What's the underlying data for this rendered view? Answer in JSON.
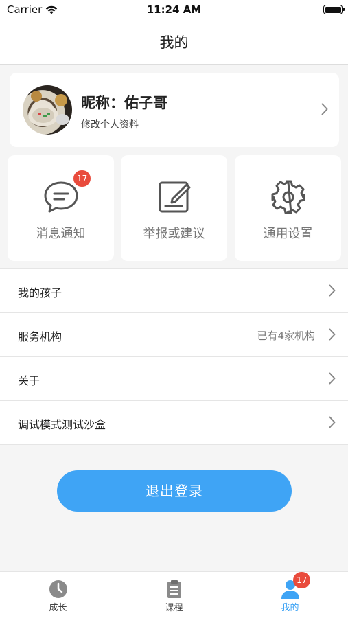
{
  "status_bar": {
    "carrier": "Carrier",
    "time": "11:24 AM"
  },
  "nav": {
    "title": "我的"
  },
  "profile": {
    "nickname": "昵称：佑子哥",
    "edit_label": "修改个人资料"
  },
  "tiles": [
    {
      "label": "消息通知",
      "icon": "chat-bubble-icon",
      "badge": "17"
    },
    {
      "label": "举报或建议",
      "icon": "edit-note-icon"
    },
    {
      "label": "通用设置",
      "icon": "gear-icon"
    }
  ],
  "list": [
    {
      "label": "我的孩子",
      "value": ""
    },
    {
      "label": "服务机构",
      "value": "已有4家机构"
    },
    {
      "label": "关于",
      "value": ""
    },
    {
      "label": "调试模式测试沙盒",
      "value": ""
    }
  ],
  "logout_label": "退出登录",
  "tab_bar": {
    "tabs": [
      {
        "label": "成长",
        "icon": "clock-icon"
      },
      {
        "label": "课程",
        "icon": "clipboard-icon"
      },
      {
        "label": "我的",
        "icon": "person-icon",
        "badge": "17",
        "active": true
      }
    ]
  },
  "colors": {
    "accent": "#3fa4f5",
    "badge": "#e94b3c",
    "background": "#f5f5f5"
  }
}
